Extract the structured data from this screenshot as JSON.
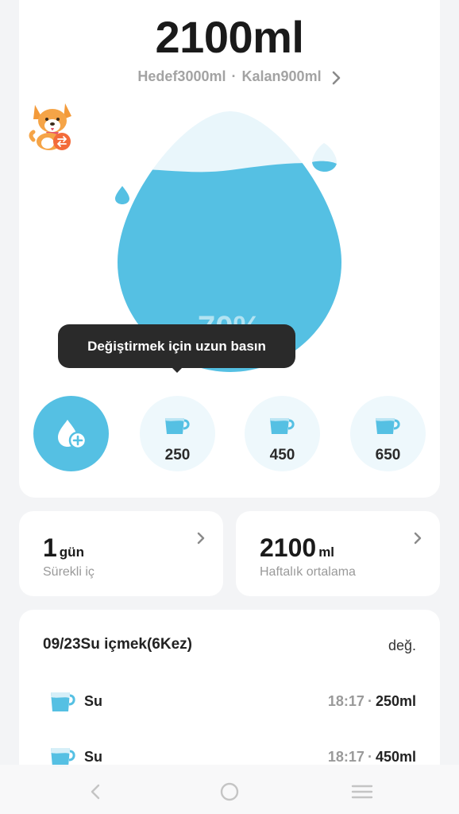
{
  "header": {
    "amount": "2100ml",
    "goal_text": "Hedef3000ml",
    "separator": "·",
    "remaining_text": "Kalan900ml"
  },
  "progress": {
    "percent_label": "70%",
    "fill_fraction": 0.7
  },
  "tooltip": {
    "text": "Değiştirmek için uzun basın"
  },
  "quick_add": {
    "add_icon": "water-drop-plus-icon",
    "cups": [
      {
        "label": "250",
        "icon": "cup-icon"
      },
      {
        "label": "450",
        "icon": "cup-icon"
      },
      {
        "label": "650",
        "icon": "cup-icon"
      }
    ]
  },
  "stats": {
    "streak": {
      "value": "1",
      "unit": "gün",
      "label": "Sürekli iç"
    },
    "weekly": {
      "value": "2100",
      "unit": "ml",
      "label": "Haftalık ortalama"
    }
  },
  "log": {
    "title": "09/23Su içmek(6Kez)",
    "edit_label": "değ.",
    "rows": [
      {
        "name": "Su",
        "time": "18:17",
        "separator": "·",
        "amount": "250ml"
      },
      {
        "name": "Su",
        "time": "18:17",
        "separator": "·",
        "amount": "450ml"
      }
    ]
  },
  "colors": {
    "water": "#55c0e3",
    "water_light": "#eef8fc",
    "tooltip": "#2a2a2a"
  },
  "nav": {
    "icons": [
      "back-icon",
      "home-icon",
      "menu-icon"
    ]
  }
}
